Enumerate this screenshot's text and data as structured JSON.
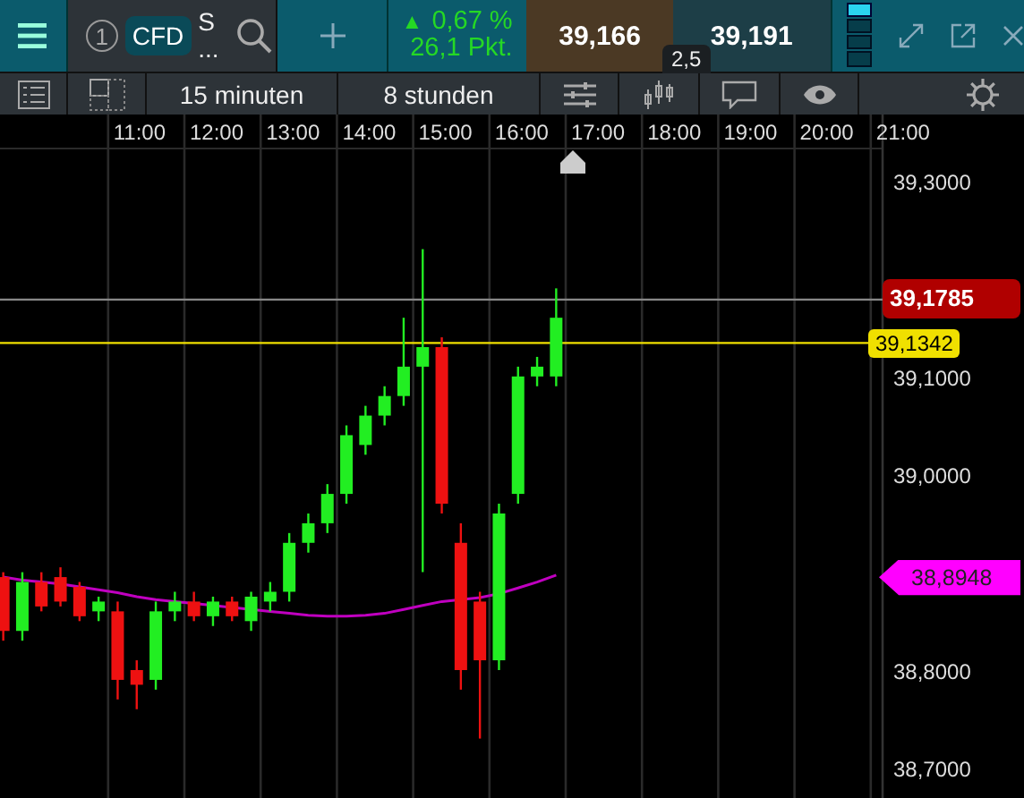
{
  "header": {
    "count": "1",
    "instrument_type": "CFD",
    "symbol": "S",
    "symbol_more": "...",
    "change_arrow": "▲",
    "change_percent": "0,67 %",
    "change_points": "26,1 Pkt.",
    "bid": "39,166",
    "ask": "39,191",
    "spread": "2,5"
  },
  "toolbar": {
    "interval": "15 minuten",
    "range": "8 stunden"
  },
  "time_axis": [
    "11:00",
    "12:00",
    "13:00",
    "14:00",
    "15:00",
    "16:00",
    "17:00",
    "18:00",
    "19:00",
    "20:00",
    "21:00"
  ],
  "price_axis": [
    "39,3000",
    "39,1000",
    "39,0000",
    "38,8000",
    "38,7000"
  ],
  "price_tags": [
    {
      "kind": "current",
      "label": "39,1785",
      "color": "#b00000"
    },
    {
      "kind": "line",
      "label": "39,1342",
      "color": "#f0e000"
    },
    {
      "kind": "arrow",
      "label": "38,8948",
      "color": "#ff00ff"
    }
  ]
}
